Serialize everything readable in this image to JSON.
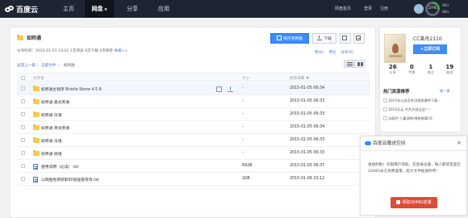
{
  "topbar": {
    "logo": "百度云",
    "nav": [
      "主页",
      "网盘",
      "分享",
      "应用"
    ],
    "active_nav": "网盘",
    "right_links": [
      "网盘首页",
      "登录",
      "注册"
    ],
    "storage_percent": "27%",
    "speed_up": "0K/s",
    "speed_down": "0K/s"
  },
  "main": {
    "title": "如师通",
    "meta_prefix": "分享时间：",
    "meta": "2015-01-07 23:01",
    "meta_tail": "1次浏览 0次下载 0次保存",
    "report": "举报>>",
    "save_button": "保存至网盘",
    "download_button": "下载",
    "actions": [
      "赞(0)",
      "评论",
      "分享(0)"
    ],
    "breadcrumb": [
      "返回上一级",
      "全部文件",
      "如师通"
    ],
    "columns": {
      "name": "文件名",
      "size": "大小",
      "date": "修改日期"
    },
    "rows": [
      {
        "name": "如师通主程序 Bristle Stone 4.5.9",
        "size": "-",
        "date": "2015-01-05 06:34",
        "icon": "folder"
      },
      {
        "name": "如师通 美式英语",
        "size": "-",
        "date": "2015-01-05 06:33",
        "icon": "folder"
      },
      {
        "name": "如师通 日语",
        "size": "-",
        "date": "2015-01-05 06:33",
        "icon": "folder"
      },
      {
        "name": "如师通 英式英语",
        "size": "-",
        "date": "2015-01-05 06:34",
        "icon": "folder"
      },
      {
        "name": "如师通 法语",
        "size": "-",
        "date": "2015-01-05 06:33",
        "icon": "folder"
      },
      {
        "name": "如师通 德语",
        "size": "-",
        "date": "2015-01-05 06:33",
        "icon": "folder"
      },
      {
        "name": "使用说明（必读）.txt",
        "size": "692B",
        "date": "2015-01-05 06:37",
        "icon": "text-file"
      },
      {
        "name": "以网盘免费获取60倍容量有效.txt",
        "size": "1KB",
        "date": "2015-01-06 23:12",
        "icon": "text-file"
      }
    ]
  },
  "sidebar": {
    "username": "CC某舟2110",
    "subscribe": "+立即订阅",
    "stats": [
      {
        "value": "26",
        "label": "分享"
      },
      {
        "value": "0",
        "label": "专辑"
      },
      {
        "value": "1",
        "label": "关注"
      },
      {
        "value": "19",
        "label": "粉丝"
      }
    ],
    "recommend_title": "热门资源推荐",
    "refresh": "换一换",
    "recommendations": [
      "2015年公务员考试视频课件下载 -",
      "2015天云 大大众创业业？！",
      "动画片·儿童读物·睡前故事10-"
    ]
  },
  "popup": {
    "title": "百度云赠送空间",
    "body": "发福利啦！仅限用户领取，先登录注册，每人即得百度云2048G永久免费容量，超大文件极速秒传！",
    "button": "领取2048G容量"
  },
  "colors": {
    "topbar": "#1e2532",
    "accent": "#3b8cff",
    "popup_button": "#dd4b39"
  }
}
